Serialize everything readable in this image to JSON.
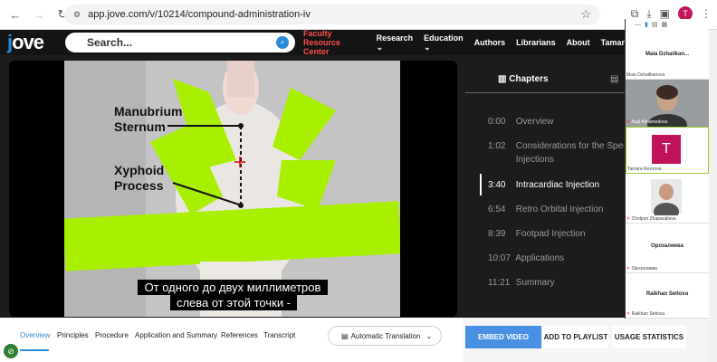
{
  "browser": {
    "url": "app.jove.com/v/10214/compound-administration-iv",
    "profile_initial": "T"
  },
  "header": {
    "logo": {
      "j": "j",
      "rest": "ove"
    },
    "search_placeholder": "Search...",
    "menu": [
      "Faculty Resource Center",
      "Research",
      "Education",
      "Authors",
      "Librarians",
      "About",
      "Tamar"
    ]
  },
  "video": {
    "labels": {
      "manubrium": "Manubrium\nSternum",
      "xyphoid": "Xyphoid\nProcess"
    },
    "subtitle_line1": "От одного до двух миллиметров",
    "subtitle_line2": "слева от этой точки -"
  },
  "chapters": {
    "tab_label": "Chapters",
    "items": [
      {
        "time": "0:00",
        "title": "Overview",
        "active": false
      },
      {
        "time": "1:02",
        "title": "Considerations for the Spec",
        "title2": "Injections",
        "active": false
      },
      {
        "time": "3:40",
        "title": "Intracardiac Injection",
        "active": true
      },
      {
        "time": "6:54",
        "title": "Retro Orbital Injection",
        "active": false
      },
      {
        "time": "8:39",
        "title": "Footpad Injection",
        "active": false
      },
      {
        "time": "10:07",
        "title": "Applications",
        "active": false
      },
      {
        "time": "11:21",
        "title": "Summary",
        "active": false
      }
    ]
  },
  "tabs": [
    "Overview",
    "Principles",
    "Procedure",
    "Application and Summary",
    "References",
    "Transcript"
  ],
  "translation_label": "Automatic Translation",
  "actions": {
    "embed": "EMBED VIDEO",
    "playlist": "ADD TO PLAYLIST",
    "usage": "USAGE STATISTICS"
  },
  "participants": [
    {
      "display": "Maia  Dzhailkan...",
      "name": "Maia Dzhailkanova",
      "type": "text"
    },
    {
      "display": "",
      "name": "Azgi Almamedova",
      "type": "video"
    },
    {
      "display": "T",
      "name": "Tamara Rezvova",
      "type": "avatar"
    },
    {
      "display": "",
      "name": "Cholpon Zhaparalieva",
      "type": "video"
    },
    {
      "display": "Орозалиева",
      "name": "Орозалиева",
      "type": "text"
    },
    {
      "display": "Raikhan Seitova",
      "name": "Raikhan Seitova",
      "type": "text"
    }
  ],
  "colors": {
    "accent": "#2b8ad8",
    "green_tape": "#a8f000",
    "zoom_avatar": "#c0125a"
  }
}
